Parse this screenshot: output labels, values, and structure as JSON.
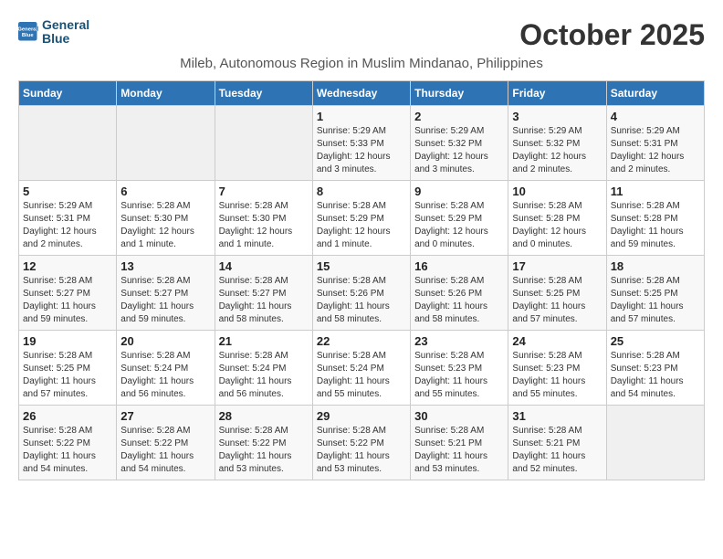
{
  "logo": {
    "line1": "General",
    "line2": "Blue"
  },
  "title": "October 2025",
  "subtitle": "Mileb, Autonomous Region in Muslim Mindanao, Philippines",
  "days_of_week": [
    "Sunday",
    "Monday",
    "Tuesday",
    "Wednesday",
    "Thursday",
    "Friday",
    "Saturday"
  ],
  "weeks": [
    [
      {
        "day": "",
        "info": ""
      },
      {
        "day": "",
        "info": ""
      },
      {
        "day": "",
        "info": ""
      },
      {
        "day": "1",
        "info": "Sunrise: 5:29 AM\nSunset: 5:33 PM\nDaylight: 12 hours and 3 minutes."
      },
      {
        "day": "2",
        "info": "Sunrise: 5:29 AM\nSunset: 5:32 PM\nDaylight: 12 hours and 3 minutes."
      },
      {
        "day": "3",
        "info": "Sunrise: 5:29 AM\nSunset: 5:32 PM\nDaylight: 12 hours and 2 minutes."
      },
      {
        "day": "4",
        "info": "Sunrise: 5:29 AM\nSunset: 5:31 PM\nDaylight: 12 hours and 2 minutes."
      }
    ],
    [
      {
        "day": "5",
        "info": "Sunrise: 5:29 AM\nSunset: 5:31 PM\nDaylight: 12 hours and 2 minutes."
      },
      {
        "day": "6",
        "info": "Sunrise: 5:28 AM\nSunset: 5:30 PM\nDaylight: 12 hours and 1 minute."
      },
      {
        "day": "7",
        "info": "Sunrise: 5:28 AM\nSunset: 5:30 PM\nDaylight: 12 hours and 1 minute."
      },
      {
        "day": "8",
        "info": "Sunrise: 5:28 AM\nSunset: 5:29 PM\nDaylight: 12 hours and 1 minute."
      },
      {
        "day": "9",
        "info": "Sunrise: 5:28 AM\nSunset: 5:29 PM\nDaylight: 12 hours and 0 minutes."
      },
      {
        "day": "10",
        "info": "Sunrise: 5:28 AM\nSunset: 5:28 PM\nDaylight: 12 hours and 0 minutes."
      },
      {
        "day": "11",
        "info": "Sunrise: 5:28 AM\nSunset: 5:28 PM\nDaylight: 11 hours and 59 minutes."
      }
    ],
    [
      {
        "day": "12",
        "info": "Sunrise: 5:28 AM\nSunset: 5:27 PM\nDaylight: 11 hours and 59 minutes."
      },
      {
        "day": "13",
        "info": "Sunrise: 5:28 AM\nSunset: 5:27 PM\nDaylight: 11 hours and 59 minutes."
      },
      {
        "day": "14",
        "info": "Sunrise: 5:28 AM\nSunset: 5:27 PM\nDaylight: 11 hours and 58 minutes."
      },
      {
        "day": "15",
        "info": "Sunrise: 5:28 AM\nSunset: 5:26 PM\nDaylight: 11 hours and 58 minutes."
      },
      {
        "day": "16",
        "info": "Sunrise: 5:28 AM\nSunset: 5:26 PM\nDaylight: 11 hours and 58 minutes."
      },
      {
        "day": "17",
        "info": "Sunrise: 5:28 AM\nSunset: 5:25 PM\nDaylight: 11 hours and 57 minutes."
      },
      {
        "day": "18",
        "info": "Sunrise: 5:28 AM\nSunset: 5:25 PM\nDaylight: 11 hours and 57 minutes."
      }
    ],
    [
      {
        "day": "19",
        "info": "Sunrise: 5:28 AM\nSunset: 5:25 PM\nDaylight: 11 hours and 57 minutes."
      },
      {
        "day": "20",
        "info": "Sunrise: 5:28 AM\nSunset: 5:24 PM\nDaylight: 11 hours and 56 minutes."
      },
      {
        "day": "21",
        "info": "Sunrise: 5:28 AM\nSunset: 5:24 PM\nDaylight: 11 hours and 56 minutes."
      },
      {
        "day": "22",
        "info": "Sunrise: 5:28 AM\nSunset: 5:24 PM\nDaylight: 11 hours and 55 minutes."
      },
      {
        "day": "23",
        "info": "Sunrise: 5:28 AM\nSunset: 5:23 PM\nDaylight: 11 hours and 55 minutes."
      },
      {
        "day": "24",
        "info": "Sunrise: 5:28 AM\nSunset: 5:23 PM\nDaylight: 11 hours and 55 minutes."
      },
      {
        "day": "25",
        "info": "Sunrise: 5:28 AM\nSunset: 5:23 PM\nDaylight: 11 hours and 54 minutes."
      }
    ],
    [
      {
        "day": "26",
        "info": "Sunrise: 5:28 AM\nSunset: 5:22 PM\nDaylight: 11 hours and 54 minutes."
      },
      {
        "day": "27",
        "info": "Sunrise: 5:28 AM\nSunset: 5:22 PM\nDaylight: 11 hours and 54 minutes."
      },
      {
        "day": "28",
        "info": "Sunrise: 5:28 AM\nSunset: 5:22 PM\nDaylight: 11 hours and 53 minutes."
      },
      {
        "day": "29",
        "info": "Sunrise: 5:28 AM\nSunset: 5:22 PM\nDaylight: 11 hours and 53 minutes."
      },
      {
        "day": "30",
        "info": "Sunrise: 5:28 AM\nSunset: 5:21 PM\nDaylight: 11 hours and 53 minutes."
      },
      {
        "day": "31",
        "info": "Sunrise: 5:28 AM\nSunset: 5:21 PM\nDaylight: 11 hours and 52 minutes."
      },
      {
        "day": "",
        "info": ""
      }
    ]
  ]
}
